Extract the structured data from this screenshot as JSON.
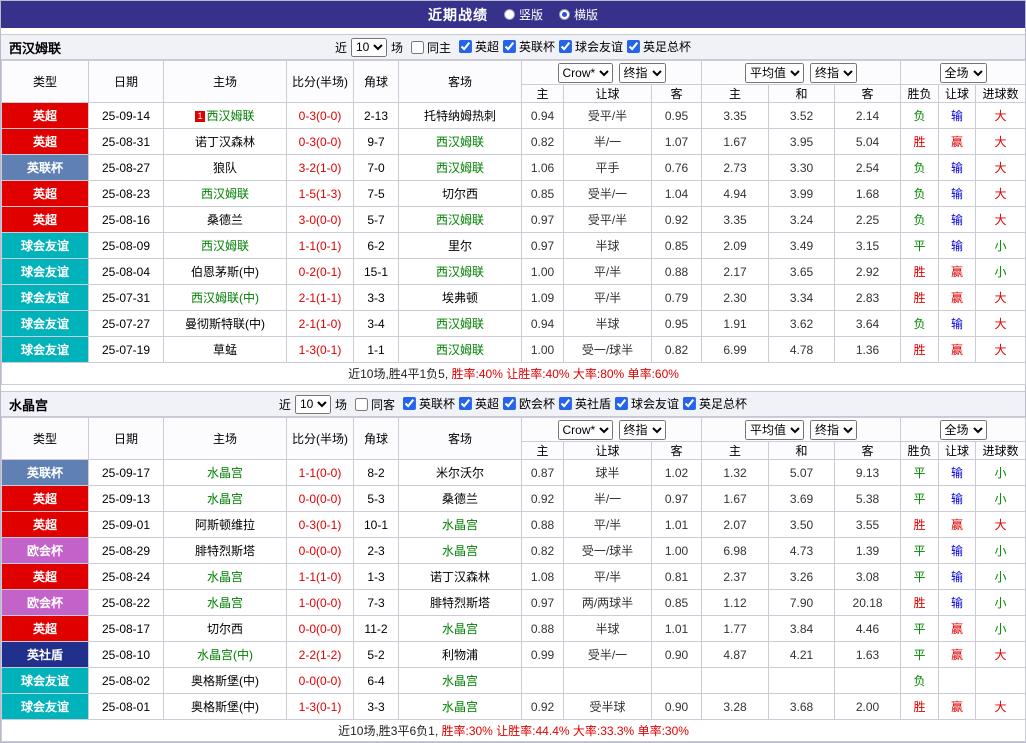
{
  "topbar": {
    "title": "近期战绩",
    "radios": [
      {
        "label": "竖版",
        "checked": false
      },
      {
        "label": "横版",
        "checked": true
      }
    ]
  },
  "colors": {
    "league_badges": {
      "英超": "#e00000",
      "英联杯": "#5f80b2",
      "球会友谊": "#00b2ba",
      "欧会杯": "#c362c8",
      "英社盾": "#22308d"
    },
    "results": {
      "red": "#e00000",
      "green": "#008800",
      "blue": "#0000dd"
    },
    "focal_team": "#008000",
    "score": "#e00000"
  },
  "sections": [
    {
      "team": "西汉姆联",
      "filter": {
        "near": "近",
        "count": "10",
        "games": "场",
        "same": {
          "label": "同主",
          "checked": false
        },
        "leagues": [
          {
            "label": "英超",
            "checked": true
          },
          {
            "label": "英联杯",
            "checked": true
          },
          {
            "label": "球会友谊",
            "checked": true
          },
          {
            "label": "英足总杯",
            "checked": true
          }
        ]
      },
      "table": {
        "static_cols": [
          "类型",
          "日期",
          "主场",
          "比分(半场)",
          "角球",
          "客场"
        ],
        "selects": [
          "Crow*",
          "终指",
          "平均值",
          "终指",
          "全场"
        ],
        "sub_cols": [
          "主",
          "让球",
          "客",
          "主",
          "和",
          "客",
          "胜负",
          "让球",
          "进球数"
        ],
        "rows": [
          {
            "league": "英超",
            "date": "25-09-14",
            "home": "西汉姆联",
            "home_focal": true,
            "home_mark": "1",
            "score": "0-3(0-0)",
            "corner": "2-13",
            "away": "托特纳姆热刺",
            "away_focal": false,
            "o1": [
              "0.94",
              "受平/半",
              "0.95"
            ],
            "o2": [
              "3.35",
              "3.52",
              "2.14"
            ],
            "res": [
              [
                "负",
                "green"
              ],
              [
                "输",
                "blue"
              ],
              [
                "大",
                "red"
              ]
            ]
          },
          {
            "league": "英超",
            "date": "25-08-31",
            "home": "诺丁汉森林",
            "home_focal": false,
            "score": "0-3(0-0)",
            "corner": "9-7",
            "away": "西汉姆联",
            "away_focal": true,
            "o1": [
              "0.82",
              "半/一",
              "1.07"
            ],
            "o2": [
              "1.67",
              "3.95",
              "5.04"
            ],
            "res": [
              [
                "胜",
                "red"
              ],
              [
                "赢",
                "red"
              ],
              [
                "大",
                "red"
              ]
            ]
          },
          {
            "league": "英联杯",
            "date": "25-08-27",
            "home": "狼队",
            "home_focal": false,
            "score": "3-2(1-0)",
            "corner": "7-0",
            "away": "西汉姆联",
            "away_focal": true,
            "o1": [
              "1.06",
              "平手",
              "0.76"
            ],
            "o2": [
              "2.73",
              "3.30",
              "2.54"
            ],
            "res": [
              [
                "负",
                "green"
              ],
              [
                "输",
                "blue"
              ],
              [
                "大",
                "red"
              ]
            ]
          },
          {
            "league": "英超",
            "date": "25-08-23",
            "home": "西汉姆联",
            "home_focal": true,
            "score": "1-5(1-3)",
            "corner": "7-5",
            "away": "切尔西",
            "away_focal": false,
            "o1": [
              "0.85",
              "受半/一",
              "1.04"
            ],
            "o2": [
              "4.94",
              "3.99",
              "1.68"
            ],
            "res": [
              [
                "负",
                "green"
              ],
              [
                "输",
                "blue"
              ],
              [
                "大",
                "red"
              ]
            ]
          },
          {
            "league": "英超",
            "date": "25-08-16",
            "home": "桑德兰",
            "home_focal": false,
            "score": "3-0(0-0)",
            "corner": "5-7",
            "away": "西汉姆联",
            "away_focal": true,
            "o1": [
              "0.97",
              "受平/半",
              "0.92"
            ],
            "o2": [
              "3.35",
              "3.24",
              "2.25"
            ],
            "res": [
              [
                "负",
                "green"
              ],
              [
                "输",
                "blue"
              ],
              [
                "大",
                "red"
              ]
            ]
          },
          {
            "league": "球会友谊",
            "date": "25-08-09",
            "home": "西汉姆联",
            "home_focal": true,
            "score": "1-1(0-1)",
            "corner": "6-2",
            "away": "里尔",
            "away_focal": false,
            "o1": [
              "0.97",
              "半球",
              "0.85"
            ],
            "o2": [
              "2.09",
              "3.49",
              "3.15"
            ],
            "res": [
              [
                "平",
                "green"
              ],
              [
                "输",
                "blue"
              ],
              [
                "小",
                "green"
              ]
            ]
          },
          {
            "league": "球会友谊",
            "date": "25-08-04",
            "home": "伯恩茅斯(中)",
            "home_focal": false,
            "score": "0-2(0-1)",
            "corner": "15-1",
            "away": "西汉姆联",
            "away_focal": true,
            "o1": [
              "1.00",
              "平/半",
              "0.88"
            ],
            "o2": [
              "2.17",
              "3.65",
              "2.92"
            ],
            "res": [
              [
                "胜",
                "red"
              ],
              [
                "赢",
                "red"
              ],
              [
                "小",
                "green"
              ]
            ]
          },
          {
            "league": "球会友谊",
            "date": "25-07-31",
            "home": "西汉姆联(中)",
            "home_focal": true,
            "score": "2-1(1-1)",
            "corner": "3-3",
            "away": "埃弗顿",
            "away_focal": false,
            "o1": [
              "1.09",
              "平/半",
              "0.79"
            ],
            "o2": [
              "2.30",
              "3.34",
              "2.83"
            ],
            "res": [
              [
                "胜",
                "red"
              ],
              [
                "赢",
                "red"
              ],
              [
                "大",
                "red"
              ]
            ]
          },
          {
            "league": "球会友谊",
            "date": "25-07-27",
            "home": "曼彻斯特联(中)",
            "home_focal": false,
            "score": "2-1(1-0)",
            "corner": "3-4",
            "away": "西汉姆联",
            "away_focal": true,
            "o1": [
              "0.94",
              "半球",
              "0.95"
            ],
            "o2": [
              "1.91",
              "3.62",
              "3.64"
            ],
            "res": [
              [
                "负",
                "green"
              ],
              [
                "输",
                "blue"
              ],
              [
                "大",
                "red"
              ]
            ]
          },
          {
            "league": "球会友谊",
            "date": "25-07-19",
            "home": "草蜢",
            "home_focal": false,
            "score": "1-3(0-1)",
            "corner": "1-1",
            "away": "西汉姆联",
            "away_focal": true,
            "o1": [
              "1.00",
              "受一/球半",
              "0.82"
            ],
            "o2": [
              "6.99",
              "4.78",
              "1.36"
            ],
            "res": [
              [
                "胜",
                "red"
              ],
              [
                "赢",
                "red"
              ],
              [
                "大",
                "red"
              ]
            ]
          }
        ],
        "footer": [
          "近10场,胜4平1负5,",
          " 胜率:40% 让胜率:40% 大率:80% 单率:60%"
        ]
      }
    },
    {
      "team": "水晶宫",
      "filter": {
        "near": "近",
        "count": "10",
        "games": "场",
        "same": {
          "label": "同客",
          "checked": false
        },
        "leagues": [
          {
            "label": "英联杯",
            "checked": true
          },
          {
            "label": "英超",
            "checked": true
          },
          {
            "label": "欧会杯",
            "checked": true
          },
          {
            "label": "英社盾",
            "checked": true
          },
          {
            "label": "球会友谊",
            "checked": true
          },
          {
            "label": "英足总杯",
            "checked": true
          }
        ]
      },
      "table": {
        "static_cols": [
          "类型",
          "日期",
          "主场",
          "比分(半场)",
          "角球",
          "客场"
        ],
        "selects": [
          "Crow*",
          "终指",
          "平均值",
          "终指",
          "全场"
        ],
        "sub_cols": [
          "主",
          "让球",
          "客",
          "主",
          "和",
          "客",
          "胜负",
          "让球",
          "进球数"
        ],
        "rows": [
          {
            "league": "英联杯",
            "date": "25-09-17",
            "home": "水晶宫",
            "home_focal": true,
            "score": "1-1(0-0)",
            "corner": "8-2",
            "away": "米尔沃尔",
            "away_focal": false,
            "o1": [
              "0.87",
              "球半",
              "1.02"
            ],
            "o2": [
              "1.32",
              "5.07",
              "9.13"
            ],
            "res": [
              [
                "平",
                "green"
              ],
              [
                "输",
                "blue"
              ],
              [
                "小",
                "green"
              ]
            ]
          },
          {
            "league": "英超",
            "date": "25-09-13",
            "home": "水晶宫",
            "home_focal": true,
            "score": "0-0(0-0)",
            "corner": "5-3",
            "away": "桑德兰",
            "away_focal": false,
            "o1": [
              "0.92",
              "半/一",
              "0.97"
            ],
            "o2": [
              "1.67",
              "3.69",
              "5.38"
            ],
            "res": [
              [
                "平",
                "green"
              ],
              [
                "输",
                "blue"
              ],
              [
                "小",
                "green"
              ]
            ]
          },
          {
            "league": "英超",
            "date": "25-09-01",
            "home": "阿斯顿维拉",
            "home_focal": false,
            "score": "0-3(0-1)",
            "corner": "10-1",
            "away": "水晶宫",
            "away_focal": true,
            "o1": [
              "0.88",
              "平/半",
              "1.01"
            ],
            "o2": [
              "2.07",
              "3.50",
              "3.55"
            ],
            "res": [
              [
                "胜",
                "red"
              ],
              [
                "赢",
                "red"
              ],
              [
                "大",
                "red"
              ]
            ]
          },
          {
            "league": "欧会杯",
            "date": "25-08-29",
            "home": "腓特烈斯塔",
            "home_focal": false,
            "score": "0-0(0-0)",
            "corner": "2-3",
            "away": "水晶宫",
            "away_focal": true,
            "o1": [
              "0.82",
              "受一/球半",
              "1.00"
            ],
            "o2": [
              "6.98",
              "4.73",
              "1.39"
            ],
            "res": [
              [
                "平",
                "green"
              ],
              [
                "输",
                "blue"
              ],
              [
                "小",
                "green"
              ]
            ]
          },
          {
            "league": "英超",
            "date": "25-08-24",
            "home": "水晶宫",
            "home_focal": true,
            "score": "1-1(1-0)",
            "corner": "1-3",
            "away": "诺丁汉森林",
            "away_focal": false,
            "o1": [
              "1.08",
              "平/半",
              "0.81"
            ],
            "o2": [
              "2.37",
              "3.26",
              "3.08"
            ],
            "res": [
              [
                "平",
                "green"
              ],
              [
                "输",
                "blue"
              ],
              [
                "小",
                "green"
              ]
            ]
          },
          {
            "league": "欧会杯",
            "date": "25-08-22",
            "home": "水晶宫",
            "home_focal": true,
            "score": "1-0(0-0)",
            "corner": "7-3",
            "away": "腓特烈斯塔",
            "away_focal": false,
            "o1": [
              "0.97",
              "两/两球半",
              "0.85"
            ],
            "o2": [
              "1.12",
              "7.90",
              "20.18"
            ],
            "res": [
              [
                "胜",
                "red"
              ],
              [
                "输",
                "blue"
              ],
              [
                "小",
                "green"
              ]
            ]
          },
          {
            "league": "英超",
            "date": "25-08-17",
            "home": "切尔西",
            "home_focal": false,
            "score": "0-0(0-0)",
            "corner": "11-2",
            "away": "水晶宫",
            "away_focal": true,
            "o1": [
              "0.88",
              "半球",
              "1.01"
            ],
            "o2": [
              "1.77",
              "3.84",
              "4.46"
            ],
            "res": [
              [
                "平",
                "green"
              ],
              [
                "赢",
                "red"
              ],
              [
                "小",
                "green"
              ]
            ]
          },
          {
            "league": "英社盾",
            "date": "25-08-10",
            "home": "水晶宫(中)",
            "home_focal": true,
            "score": "2-2(1-2)",
            "corner": "5-2",
            "away": "利物浦",
            "away_focal": false,
            "o1": [
              "0.99",
              "受半/一",
              "0.90"
            ],
            "o2": [
              "4.87",
              "4.21",
              "1.63"
            ],
            "res": [
              [
                "平",
                "green"
              ],
              [
                "赢",
                "red"
              ],
              [
                "大",
                "red"
              ]
            ]
          },
          {
            "league": "球会友谊",
            "date": "25-08-02",
            "home": "奥格斯堡(中)",
            "home_focal": false,
            "score": "0-0(0-0)",
            "corner": "6-4",
            "away": "水晶宫",
            "away_focal": true,
            "o1": [
              "",
              "",
              ""
            ],
            "o2": [
              "",
              "",
              ""
            ],
            "res": [
              [
                "负",
                "green"
              ],
              [
                "",
                ""
              ],
              [
                "",
                ""
              ]
            ]
          },
          {
            "league": "球会友谊",
            "date": "25-08-01",
            "home": "奥格斯堡(中)",
            "home_focal": false,
            "score": "1-3(0-1)",
            "corner": "3-3",
            "away": "水晶宫",
            "away_focal": true,
            "o1": [
              "0.92",
              "受半球",
              "0.90"
            ],
            "o2": [
              "3.28",
              "3.68",
              "2.00"
            ],
            "res": [
              [
                "胜",
                "red"
              ],
              [
                "赢",
                "red"
              ],
              [
                "大",
                "red"
              ]
            ]
          }
        ],
        "footer": [
          "近10场,胜3平6负1,",
          " 胜率:30% 让胜率:44.4% 大率:33.3% 单率:30%"
        ]
      }
    }
  ]
}
